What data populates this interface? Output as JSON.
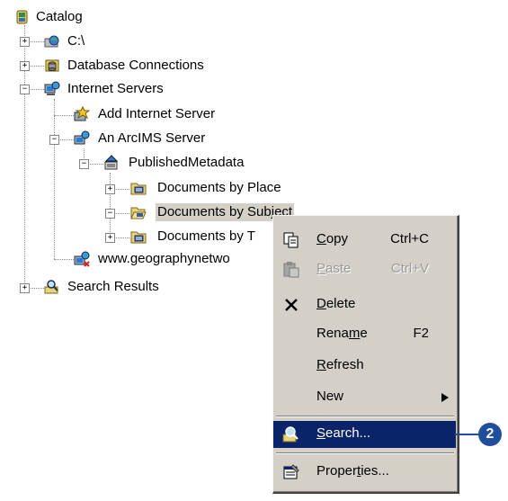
{
  "tree": {
    "root": "Catalog",
    "items": [
      {
        "label": "C:\\"
      },
      {
        "label": "Database Connections"
      },
      {
        "label": "Internet Servers"
      },
      {
        "label": "Add Internet Server"
      },
      {
        "label": "An ArcIMS Server"
      },
      {
        "label": "PublishedMetadata"
      },
      {
        "label": "Documents by Place"
      },
      {
        "label": "Documents by Subject"
      },
      {
        "label": "Documents by T"
      },
      {
        "label": "www.geographynetwo"
      },
      {
        "label": "Search Results"
      }
    ]
  },
  "context_menu": {
    "copy": {
      "pre": "",
      "key": "C",
      "post": "opy",
      "shortcut": "Ctrl+C"
    },
    "paste": {
      "pre": "",
      "key": "P",
      "post": "aste",
      "shortcut": "Ctrl+V"
    },
    "delete": {
      "pre": "",
      "key": "D",
      "post": "elete"
    },
    "rename": {
      "pre": "Rena",
      "key": "m",
      "post": "e",
      "shortcut": "F2"
    },
    "refresh": {
      "pre": "",
      "key": "R",
      "post": "efresh"
    },
    "new": {
      "label": "New"
    },
    "search": {
      "pre": "",
      "key": "S",
      "post": "earch..."
    },
    "properties": {
      "pre": "Proper",
      "key": "t",
      "post": "ies..."
    }
  },
  "callout": {
    "number": "2"
  },
  "colors": {
    "highlight": "#0a246a",
    "callout": "#1f4f9c",
    "menu_bg": "#d4d0c8"
  }
}
